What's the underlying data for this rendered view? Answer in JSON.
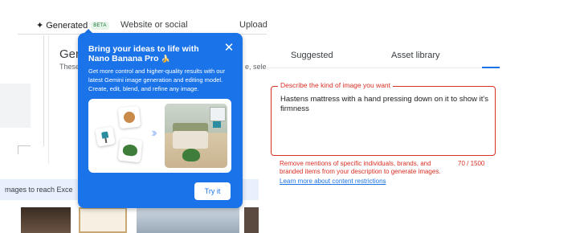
{
  "tabs": {
    "generated_label": "Generated",
    "generated_badge": "BETA",
    "website_label": "Website or social",
    "upload_label": "Upload"
  },
  "background": {
    "title": "Gen",
    "subtitle": "These",
    "subtitle_right": "e, sele",
    "banner_text": "mages to reach Exce"
  },
  "popup": {
    "title": "Bring your ideas to life with Nano Banana Pro",
    "title_emoji": "🍌",
    "body": "Get more control and higher-quality results with our latest Gemini image generation and editing model. Create, edit, blend, and refine any image.",
    "try_label": "Try it",
    "chevrons": "›››"
  },
  "right_panel": {
    "tab_suggested": "Suggested",
    "tab_asset_library": "Asset library",
    "prompt_label": "Describe the kind of image you want",
    "prompt_value": "Hastens mattress with a hand pressing down on it to show it's firmness",
    "helper_text": "Remove mentions of specific individuals, brands, and branded items from your description to generate images.",
    "counter": "70 / 1500",
    "learn_more": "Learn more about content restrictions"
  },
  "colors": {
    "accent": "#1a73e8",
    "error": "#d93025",
    "beta_bg": "#e6f4ea",
    "beta_text": "#137333"
  }
}
